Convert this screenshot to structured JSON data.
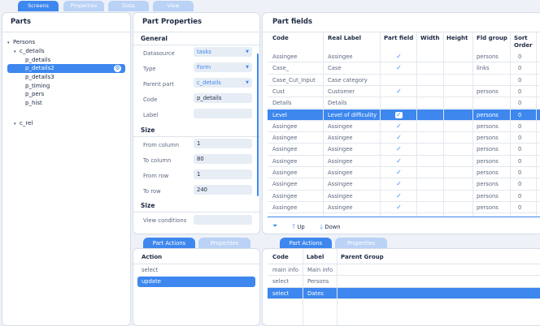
{
  "top_tabs": [
    "Screens",
    "Properties",
    "Data",
    "View"
  ],
  "parts": {
    "title": "Parts",
    "tree": [
      {
        "label": "Persons",
        "level": 0,
        "caret": "▾"
      },
      {
        "label": "c_details",
        "level": 1,
        "caret": "▾"
      },
      {
        "label": "p_details",
        "level": 2,
        "caret": ""
      },
      {
        "label": "p_details2",
        "level": 2,
        "caret": "",
        "selected": true
      },
      {
        "label": "p_details3",
        "level": 2,
        "caret": ""
      },
      {
        "label": "p_timing",
        "level": 2,
        "caret": ""
      },
      {
        "label": "p_pers",
        "level": 2,
        "caret": ""
      },
      {
        "label": "p_hist",
        "level": 2,
        "caret": ""
      },
      {
        "label": "c_rel",
        "level": 1,
        "caret": "▾"
      }
    ]
  },
  "part_properties": {
    "title": "Part Properties",
    "general_head": "General",
    "datasource_label": "Datasource",
    "datasource_value": "tasks",
    "type_label": "Type",
    "type_value": "Form",
    "parent_label": "Parent part",
    "parent_value": "c_details",
    "code_label": "Code",
    "code_value": "p_details",
    "label_label": "Label",
    "label_value": "",
    "size_head": "Size",
    "from_col_label": "From column",
    "from_col_value": "1",
    "to_col_label": "To column",
    "to_col_value": "80",
    "from_row_label": "From row",
    "from_row_value": "1",
    "to_row_label": "To row",
    "to_row_value": "240",
    "size_head2": "Size",
    "view_cond_label": "View conditions",
    "view_cond_value": ""
  },
  "part_fields": {
    "title": "Part fields",
    "headers": {
      "code": "Code",
      "real_label": "Real Label",
      "part_field": "Part field",
      "width": "Width",
      "height": "Height",
      "fld_group": "Fld group",
      "sort_order_1": "Sort",
      "sort_order_2": "Order"
    },
    "rows": [
      {
        "code": "Assingee",
        "real": "Assingee",
        "pf": true,
        "group": "persons",
        "sort": "0"
      },
      {
        "code": "Case_",
        "real": "Case",
        "pf": true,
        "group": "links",
        "sort": "0"
      },
      {
        "code": "Case_Cut_Input",
        "real": "Case category",
        "pf": false,
        "group": "",
        "sort": "0"
      },
      {
        "code": "Cust",
        "real": "Customer",
        "pf": true,
        "group": "persons",
        "sort": "0"
      },
      {
        "code": "Details",
        "real": "Details",
        "pf": false,
        "group": "",
        "sort": "0"
      },
      {
        "code": "Level",
        "real": "Level of difficulity",
        "pf": true,
        "group": "persons",
        "sort": "0",
        "selected": true
      },
      {
        "code": "Assingee",
        "real": "Assingee",
        "pf": true,
        "group": "persons",
        "sort": "0"
      },
      {
        "code": "Assingee",
        "real": "Assingee",
        "pf": true,
        "group": "persons",
        "sort": "0"
      },
      {
        "code": "Assingee",
        "real": "Assingee",
        "pf": true,
        "group": "persons",
        "sort": "0"
      },
      {
        "code": "Assingee",
        "real": "Assingee",
        "pf": true,
        "group": "persons",
        "sort": "0"
      },
      {
        "code": "Assingee",
        "real": "Assingee",
        "pf": true,
        "group": "persons",
        "sort": "0"
      },
      {
        "code": "Assingee",
        "real": "Assingee",
        "pf": true,
        "group": "persons",
        "sort": "0"
      },
      {
        "code": "Assingee",
        "real": "Assingee",
        "pf": true,
        "group": "persons",
        "sort": "0"
      },
      {
        "code": "Assingee",
        "real": "Assingee",
        "pf": true,
        "group": "persons",
        "sort": "0"
      }
    ],
    "toolbar": {
      "up": "Up",
      "down": "Down"
    }
  },
  "part_actions": {
    "tabs": [
      "Part Actions",
      "Properties"
    ],
    "header": "Action",
    "rows": [
      {
        "label": "select"
      },
      {
        "label": "update",
        "selected": true
      }
    ]
  },
  "bottom_grid": {
    "tabs": [
      "Part Actions",
      "Properties"
    ],
    "headers": {
      "code": "Code",
      "label": "Label",
      "parent": "Parent Group"
    },
    "rows": [
      {
        "code": "main info",
        "label": "Main info",
        "parent": ""
      },
      {
        "code": "select",
        "label": "Persons",
        "parent": ""
      },
      {
        "code": "select",
        "label": "Dates",
        "parent": "",
        "selected": true
      }
    ]
  }
}
